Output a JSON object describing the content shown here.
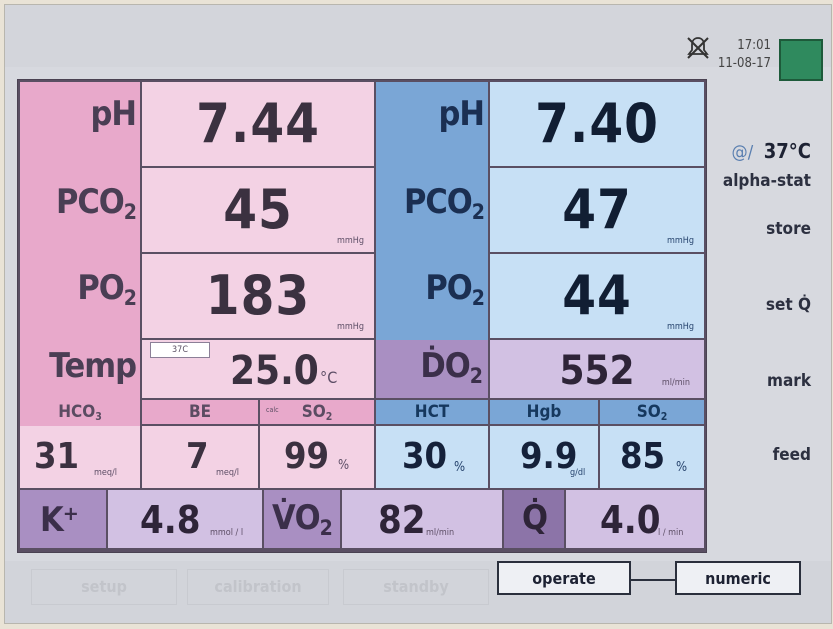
{
  "header": {
    "time": "17:01",
    "date": "11-08-17"
  },
  "left": {
    "ph": {
      "label": "pH",
      "value": "7.44"
    },
    "pco2": {
      "label": "PCO",
      "sub": "2",
      "value": "45",
      "unit": "mmHg"
    },
    "po2": {
      "label": "PO",
      "sub": "2",
      "value": "183",
      "unit": "mmHg"
    },
    "temp": {
      "label": "Temp",
      "value": "25.0",
      "unit": "°C",
      "badge": "37C"
    }
  },
  "right": {
    "ph": {
      "label": "pH",
      "value": "7.40"
    },
    "pco2": {
      "label": "PCO",
      "sub": "2",
      "value": "47",
      "unit": "mmHg"
    },
    "po2": {
      "label": "PO",
      "sub": "2",
      "value": "44",
      "unit": "mmHg"
    },
    "do2": {
      "label": "ḊO",
      "sub": "2",
      "value": "552",
      "unit": "ml/min"
    }
  },
  "middle_row": {
    "headers": {
      "hco3": "HCO",
      "hco3_sub": "3",
      "be": "BE",
      "calc": "calc",
      "so2": "SO",
      "so2_sub": "2",
      "hct": "HCT",
      "hgb": "Hgb",
      "so2b": "SO",
      "so2b_sub": "2"
    },
    "hco3": {
      "value": "31",
      "unit": "meq/l"
    },
    "be": {
      "value": "7",
      "unit": "meq/l"
    },
    "so2": {
      "value": "99",
      "unit": "%"
    },
    "hct": {
      "value": "30",
      "unit": "%"
    },
    "hgb": {
      "value": "9.9",
      "unit": "g/dl"
    },
    "so2b": {
      "value": "85",
      "unit": "%"
    }
  },
  "bottom_row": {
    "k": {
      "label": "K⁺",
      "value": "4.8",
      "unit": "mmol / l"
    },
    "vo2": {
      "label": "V̇O",
      "sub": "2",
      "value": "82",
      "unit": "ml/min"
    },
    "q": {
      "label": "Q̇",
      "value": "4.0",
      "unit": "l / min"
    }
  },
  "sidebar": {
    "at_label": "@/",
    "temp_setting": "37°C",
    "alpha_stat": "alpha-stat",
    "store": "store",
    "set_q": "set Q̇",
    "mark": "mark",
    "feed": "feed"
  },
  "footer": {
    "ghost1": "setup",
    "ghost2": "calibration",
    "ghost3": "standby",
    "operate": "operate",
    "numeric": "numeric"
  },
  "colors": {
    "left_label_bg": "#e8a9cb",
    "left_value_bg": "#f3d2e4",
    "right_label_bg": "#7aa6d6",
    "right_value_bg": "#c7e0f5",
    "purple_label_bg": "#a98fc2",
    "purple_value_bg": "#d2c1e3",
    "status_green": "#2f8a5e"
  }
}
